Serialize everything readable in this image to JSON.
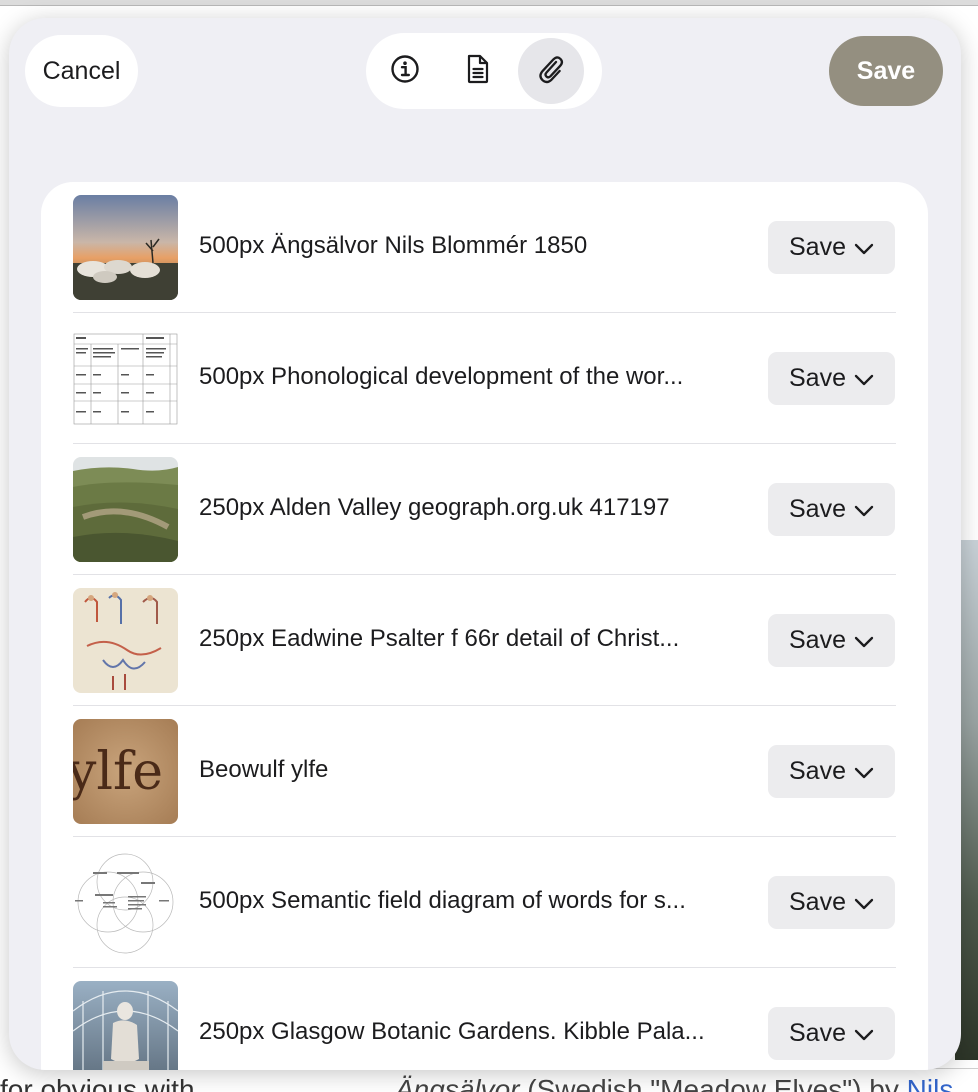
{
  "background": {
    "bottom_text_italic": "Ängsälvor",
    "bottom_text_plain": " (Swedish \"Meadow Elves\") by ",
    "bottom_text_link": "Nils",
    "left_fragment": "for obvious with"
  },
  "toolbar": {
    "cancel_label": "Cancel",
    "save_label": "Save",
    "segments": [
      {
        "icon": "info-icon",
        "selected": false
      },
      {
        "icon": "document-icon",
        "selected": false
      },
      {
        "icon": "paperclip-icon",
        "selected": true
      }
    ],
    "save_button_color": "#948f80"
  },
  "attachments": [
    {
      "title": "500px Ängsälvor Nils Blommér 1850",
      "save_label": "Save"
    },
    {
      "title": "500px Phonological development of the wor...",
      "save_label": "Save"
    },
    {
      "title": "250px Alden Valley geograph.org.uk 417197",
      "save_label": "Save"
    },
    {
      "title": "250px Eadwine Psalter f 66r detail of Christ...",
      "save_label": "Save"
    },
    {
      "title": "Beowulf ylfe",
      "save_label": "Save",
      "thumb_text": "ylfe"
    },
    {
      "title": "500px Semantic field diagram of words for s...",
      "save_label": "Save"
    },
    {
      "title": "250px Glasgow Botanic Gardens. Kibble Pala...",
      "save_label": "Save"
    }
  ]
}
